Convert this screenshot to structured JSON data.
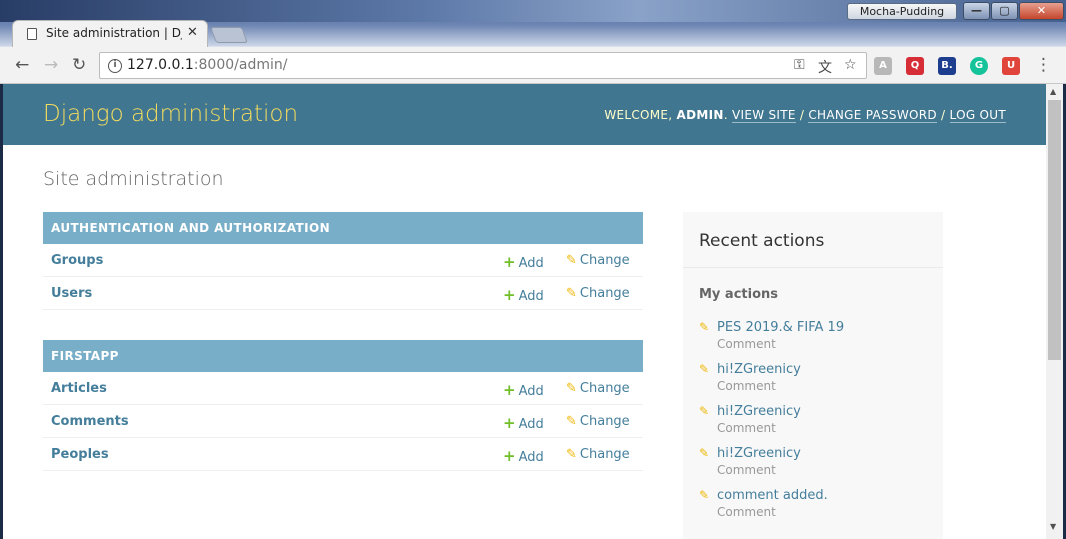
{
  "window": {
    "profile_name": "Mocha-Pudding",
    "minimize_symbol": "—",
    "maximize_symbol": "▢",
    "close_symbol": "✕"
  },
  "tab": {
    "title": "Site administration | Djan",
    "close_symbol": "✕"
  },
  "toolbar": {
    "back_symbol": "←",
    "forward_symbol": "→",
    "reload_symbol": "↻",
    "url_host": "127.0.0.1",
    "url_path": ":8000/admin/",
    "key_symbol": "⚿",
    "translate_symbol": "⽂",
    "star_symbol": "☆",
    "menu_symbol": "⋮",
    "extensions": [
      {
        "label": "A",
        "color": "#b8b8b8"
      },
      {
        "label": "Q",
        "color": "#d62d36"
      },
      {
        "label": "B.",
        "color": "#1d3e8f"
      },
      {
        "label": "G",
        "color": "#15c39a"
      },
      {
        "label": "U",
        "color": "#e0443a"
      }
    ]
  },
  "header": {
    "branding": "Django administration",
    "welcome": "WELCOME, ",
    "username": "ADMIN",
    "separator_1": ". ",
    "view_site": "VIEW SITE",
    "slash": " / ",
    "change_password": "CHANGE PASSWORD",
    "log_out": "LOG OUT"
  },
  "content": {
    "title": "Site administration",
    "add_label": "Add",
    "change_label": "Change",
    "add_symbol": "+",
    "change_symbol": "✎",
    "apps": [
      {
        "caption": "AUTHENTICATION AND AUTHORIZATION",
        "models": [
          "Groups",
          "Users"
        ]
      },
      {
        "caption": "FIRSTAPP",
        "models": [
          "Articles",
          "Comments",
          "Peoples"
        ]
      }
    ]
  },
  "recent_actions": {
    "title": "Recent actions",
    "subtitle": "My actions",
    "icon_symbol": "✎",
    "items": [
      {
        "name": "PES 2019.& FIFA 19",
        "type": "Comment"
      },
      {
        "name": "hi!ZGreenicy",
        "type": "Comment"
      },
      {
        "name": "hi!ZGreenicy",
        "type": "Comment"
      },
      {
        "name": "hi!ZGreenicy",
        "type": "Comment"
      },
      {
        "name": "comment added.",
        "type": "Comment"
      }
    ]
  },
  "scrollbar": {
    "up_symbol": "▲",
    "down_symbol": "▼"
  }
}
